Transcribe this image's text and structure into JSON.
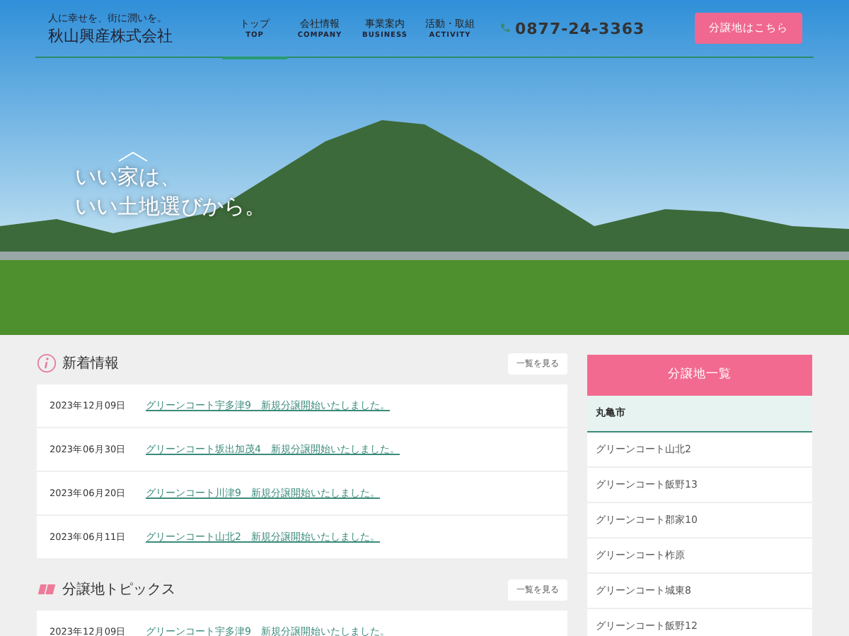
{
  "header": {
    "tagline": "人に幸せを、街に潤いを。",
    "company": "秋山興産株式会社",
    "nav": [
      {
        "label": "トップ",
        "sub": "TOP",
        "selected": true
      },
      {
        "label": "会社情報",
        "sub": "COMPANY",
        "selected": false
      },
      {
        "label": "事業案内",
        "sub": "BUSINESS",
        "selected": false
      },
      {
        "label": "活動・取組",
        "sub": "ACTIVITY",
        "selected": false
      }
    ],
    "phone": "0877-24-3363",
    "cta": "分譲地はこちら"
  },
  "hero": {
    "lines": [
      "いい家は、",
      "いい土地選びから。"
    ]
  },
  "sections": [
    {
      "kind": "info",
      "title": "新着情報",
      "more": "一覧を見る",
      "items": [
        {
          "date": "2023年12月09日",
          "text": "グリーンコート宇多津9　新規分譲開始いたしました。"
        },
        {
          "date": "2023年06月30日",
          "text": "グリーンコート坂出加茂4　新規分譲開始いたしました。"
        },
        {
          "date": "2023年06月20日",
          "text": "グリーンコート川津9　新規分譲開始いたしました。"
        },
        {
          "date": "2023年06月11日",
          "text": "グリーンコート山北2　新規分譲開始いたしました。"
        }
      ]
    },
    {
      "kind": "topics",
      "title": "分譲地トピックス",
      "more": "一覧を見る",
      "items": [
        {
          "date": "2023年12月09日",
          "text": "グリーンコート宇多津9　新規分譲開始いたしました。"
        }
      ]
    }
  ],
  "sidebar": {
    "title": "分譲地一覧",
    "city": "丸亀市",
    "items": [
      "グリーンコート山北2",
      "グリーンコート飯野13",
      "グリーンコート郡家10",
      "グリーンコート柞原",
      "グリーンコート城東8",
      "グリーンコート飯野12"
    ]
  }
}
